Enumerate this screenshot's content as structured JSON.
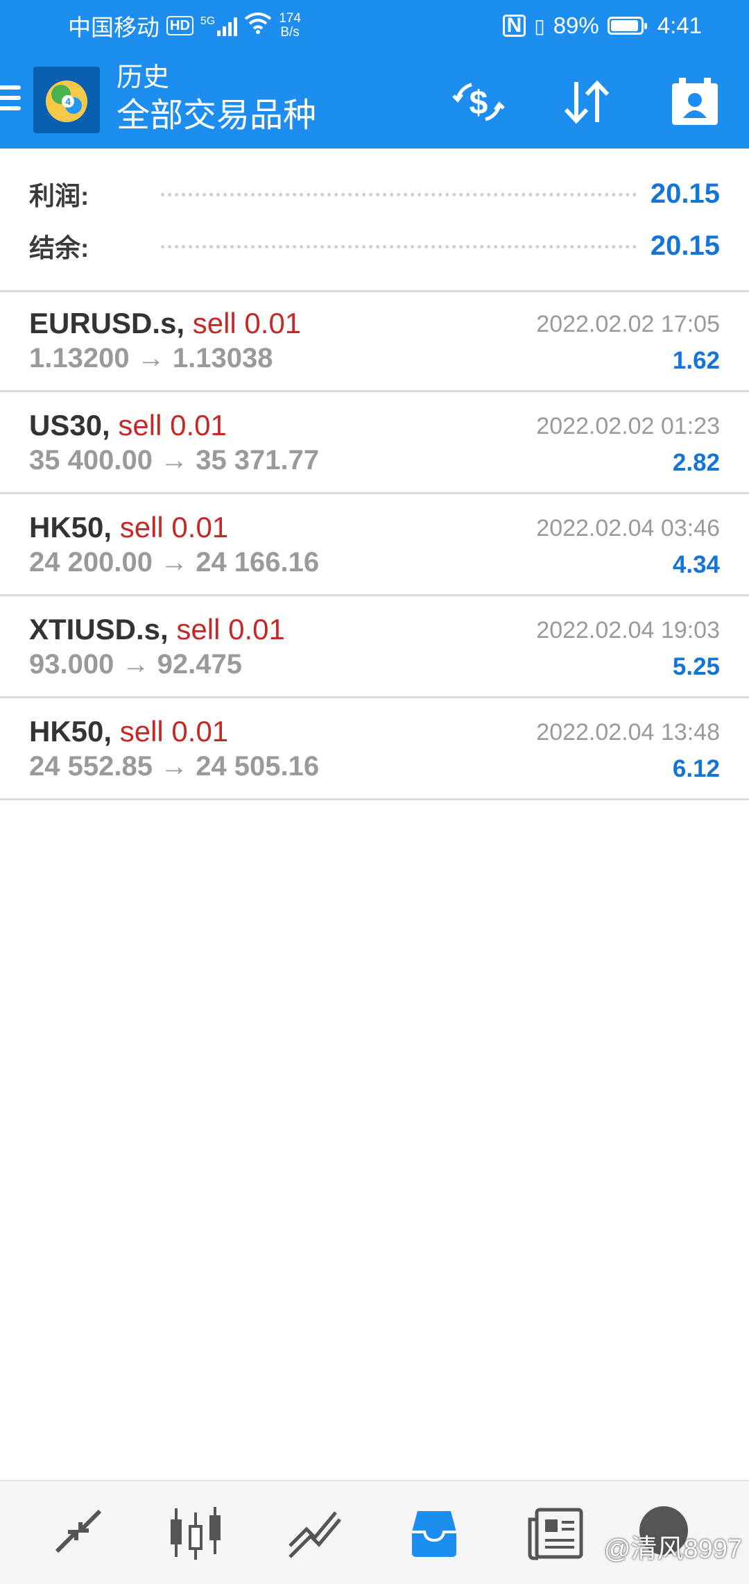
{
  "status_bar": {
    "carrier": "中国移动",
    "hd": "HD",
    "network": "5G",
    "speed_value": "174",
    "speed_unit": "B/s",
    "battery": "89%",
    "battery_level": 0.89,
    "time": "4:41"
  },
  "header": {
    "section": "历史",
    "title": "全部交易品种",
    "icons": [
      "menu-icon",
      "currency-exchange-icon",
      "sort-icon",
      "account-icon"
    ]
  },
  "summary": {
    "profit_label": "利润:",
    "profit_value": "20.15",
    "balance_label": "结余:",
    "balance_value": "20.15"
  },
  "deals": [
    {
      "symbol": "EURUSD.s,",
      "type": "sell 0.01",
      "open": "1.13200",
      "close": "1.13038",
      "time": "2022.02.02 17:05",
      "profit": "1.62"
    },
    {
      "symbol": "US30,",
      "type": "sell 0.01",
      "open": "35 400.00",
      "close": "35 371.77",
      "time": "2022.02.02 01:23",
      "profit": "2.82"
    },
    {
      "symbol": "HK50,",
      "type": "sell 0.01",
      "open": "24 200.00",
      "close": "24 166.16",
      "time": "2022.02.04 03:46",
      "profit": "4.34"
    },
    {
      "symbol": "XTIUSD.s,",
      "type": "sell 0.01",
      "open": "93.000",
      "close": "92.475",
      "time": "2022.02.04 19:03",
      "profit": "5.25"
    },
    {
      "symbol": "HK50,",
      "type": "sell 0.01",
      "open": "24 552.85",
      "close": "24 505.16",
      "time": "2022.02.04 13:48",
      "profit": "6.12"
    }
  ],
  "arrow": "→",
  "bottom_nav": {
    "items": [
      "quotes-icon",
      "chart-icon",
      "trade-icon",
      "history-icon",
      "news-icon"
    ],
    "active": "history-icon",
    "watermark": "@清风8997"
  },
  "colors": {
    "accent": "#1d8ef0",
    "profit": "#1474d8",
    "sell": "#c62828"
  }
}
